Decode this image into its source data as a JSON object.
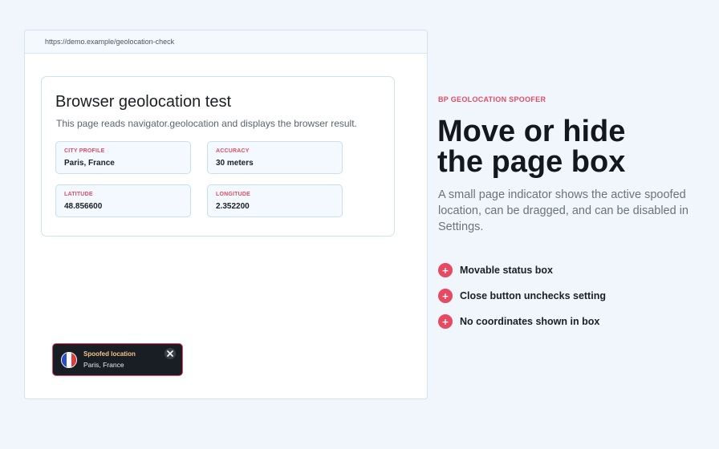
{
  "browser": {
    "url": "https://demo.example/geolocation-check"
  },
  "test_card": {
    "title": "Browser geolocation test",
    "description": "This page reads navigator.geolocation and displays the browser result.",
    "fields": [
      {
        "label": "CITY PROFILE",
        "value": "Paris, France"
      },
      {
        "label": "ACCURACY",
        "value": "30 meters"
      },
      {
        "label": "LATITUDE",
        "value": "48.856600"
      },
      {
        "label": "LONGITUDE",
        "value": "2.352200"
      }
    ]
  },
  "spoof_indicator": {
    "title": "Spoofed location",
    "city": "Paris, France",
    "flag_icon": "france-flag-icon",
    "close_icon": "close-icon"
  },
  "promo": {
    "eyebrow": "BP GEOLOCATION SPOOFER",
    "headline": "Move or hide the page box",
    "lead": "A small page indicator shows the active spoofed location, can be dragged, and can be disabled in Settings.",
    "features": [
      {
        "label": "Movable status box",
        "icon": "plus-icon"
      },
      {
        "label": "Close button unchecks setting",
        "icon": "plus-icon"
      },
      {
        "label": "No coordinates shown in box",
        "icon": "plus-icon"
      }
    ]
  },
  "colors": {
    "accent": "#e44b62",
    "background": "#f0f6fc",
    "indicator_bg": "#191d24",
    "indicator_title": "#f4c58a"
  }
}
